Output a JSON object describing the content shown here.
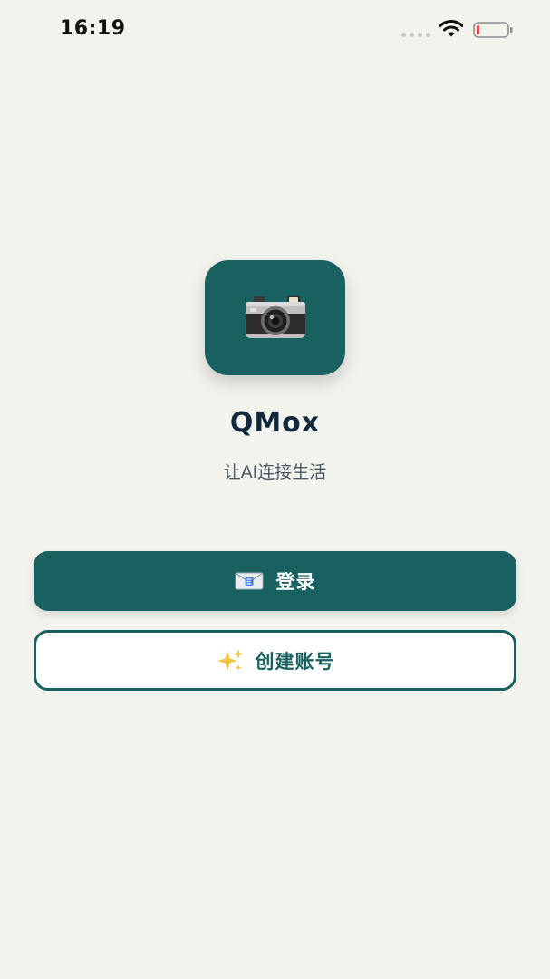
{
  "status_bar": {
    "time": "16:19",
    "icons": [
      "signal-dots-icon",
      "wifi-icon",
      "battery-low-icon"
    ]
  },
  "app": {
    "logo_icon": "camera-icon",
    "name": "QMox",
    "tagline": "让AI连接生活"
  },
  "buttons": {
    "login": {
      "icon": "envelope-icon",
      "label": "登录"
    },
    "create_account": {
      "icon": "sparkles-icon",
      "label": "创建账号"
    }
  },
  "colors": {
    "background": "#f3f3ee",
    "primary": "#186160",
    "title": "#13283a",
    "battery_low": "#e5483b"
  }
}
